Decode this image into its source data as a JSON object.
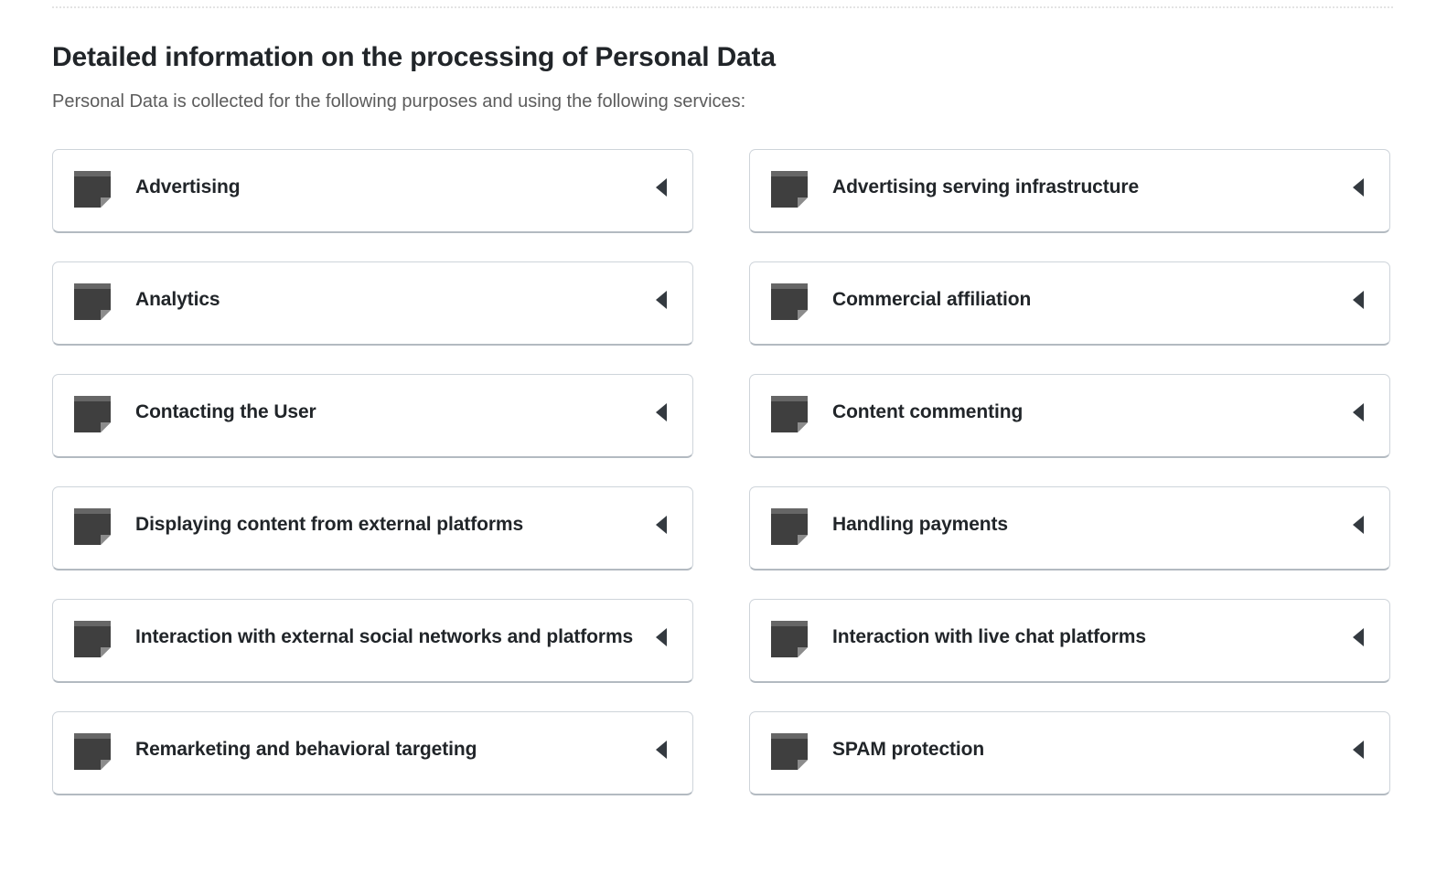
{
  "header": {
    "title": "Detailed information on the processing of Personal Data",
    "subtitle": "Personal Data is collected for the following purposes and using the following services:"
  },
  "colors": {
    "title_text": "#212529",
    "subtitle_text": "#5c5c5c",
    "card_background": "#ffffff",
    "card_border": "#ced4da",
    "card_border_bottom": "#b3bac1",
    "icon_body": "#3f3f3f",
    "icon_top_bar": "#666666",
    "icon_fold": "#8c8c8c",
    "arrow": "#343a40",
    "divider": "#e3e3e3"
  },
  "icons": {
    "card": "document-icon",
    "toggle": "triangle-left-icon"
  },
  "columns": {
    "left": [
      {
        "label": "Advertising",
        "icon": "document-icon",
        "arrow": "triangle-left-icon"
      },
      {
        "label": "Analytics",
        "icon": "document-icon",
        "arrow": "triangle-left-icon"
      },
      {
        "label": "Contacting the User",
        "icon": "document-icon",
        "arrow": "triangle-left-icon"
      },
      {
        "label": "Displaying content from external platforms",
        "icon": "document-icon",
        "arrow": "triangle-left-icon"
      },
      {
        "label": "Interaction with external social networks and platforms",
        "icon": "document-icon",
        "arrow": "triangle-left-icon"
      },
      {
        "label": "Remarketing and behavioral targeting",
        "icon": "document-icon",
        "arrow": "triangle-left-icon"
      }
    ],
    "right": [
      {
        "label": "Advertising serving infrastructure",
        "icon": "document-icon",
        "arrow": "triangle-left-icon"
      },
      {
        "label": "Commercial affiliation",
        "icon": "document-icon",
        "arrow": "triangle-left-icon"
      },
      {
        "label": "Content commenting",
        "icon": "document-icon",
        "arrow": "triangle-left-icon"
      },
      {
        "label": "Handling payments",
        "icon": "document-icon",
        "arrow": "triangle-left-icon"
      },
      {
        "label": "Interaction with live chat platforms",
        "icon": "document-icon",
        "arrow": "triangle-left-icon"
      },
      {
        "label": "SPAM protection",
        "icon": "document-icon",
        "arrow": "triangle-left-icon"
      }
    ]
  }
}
